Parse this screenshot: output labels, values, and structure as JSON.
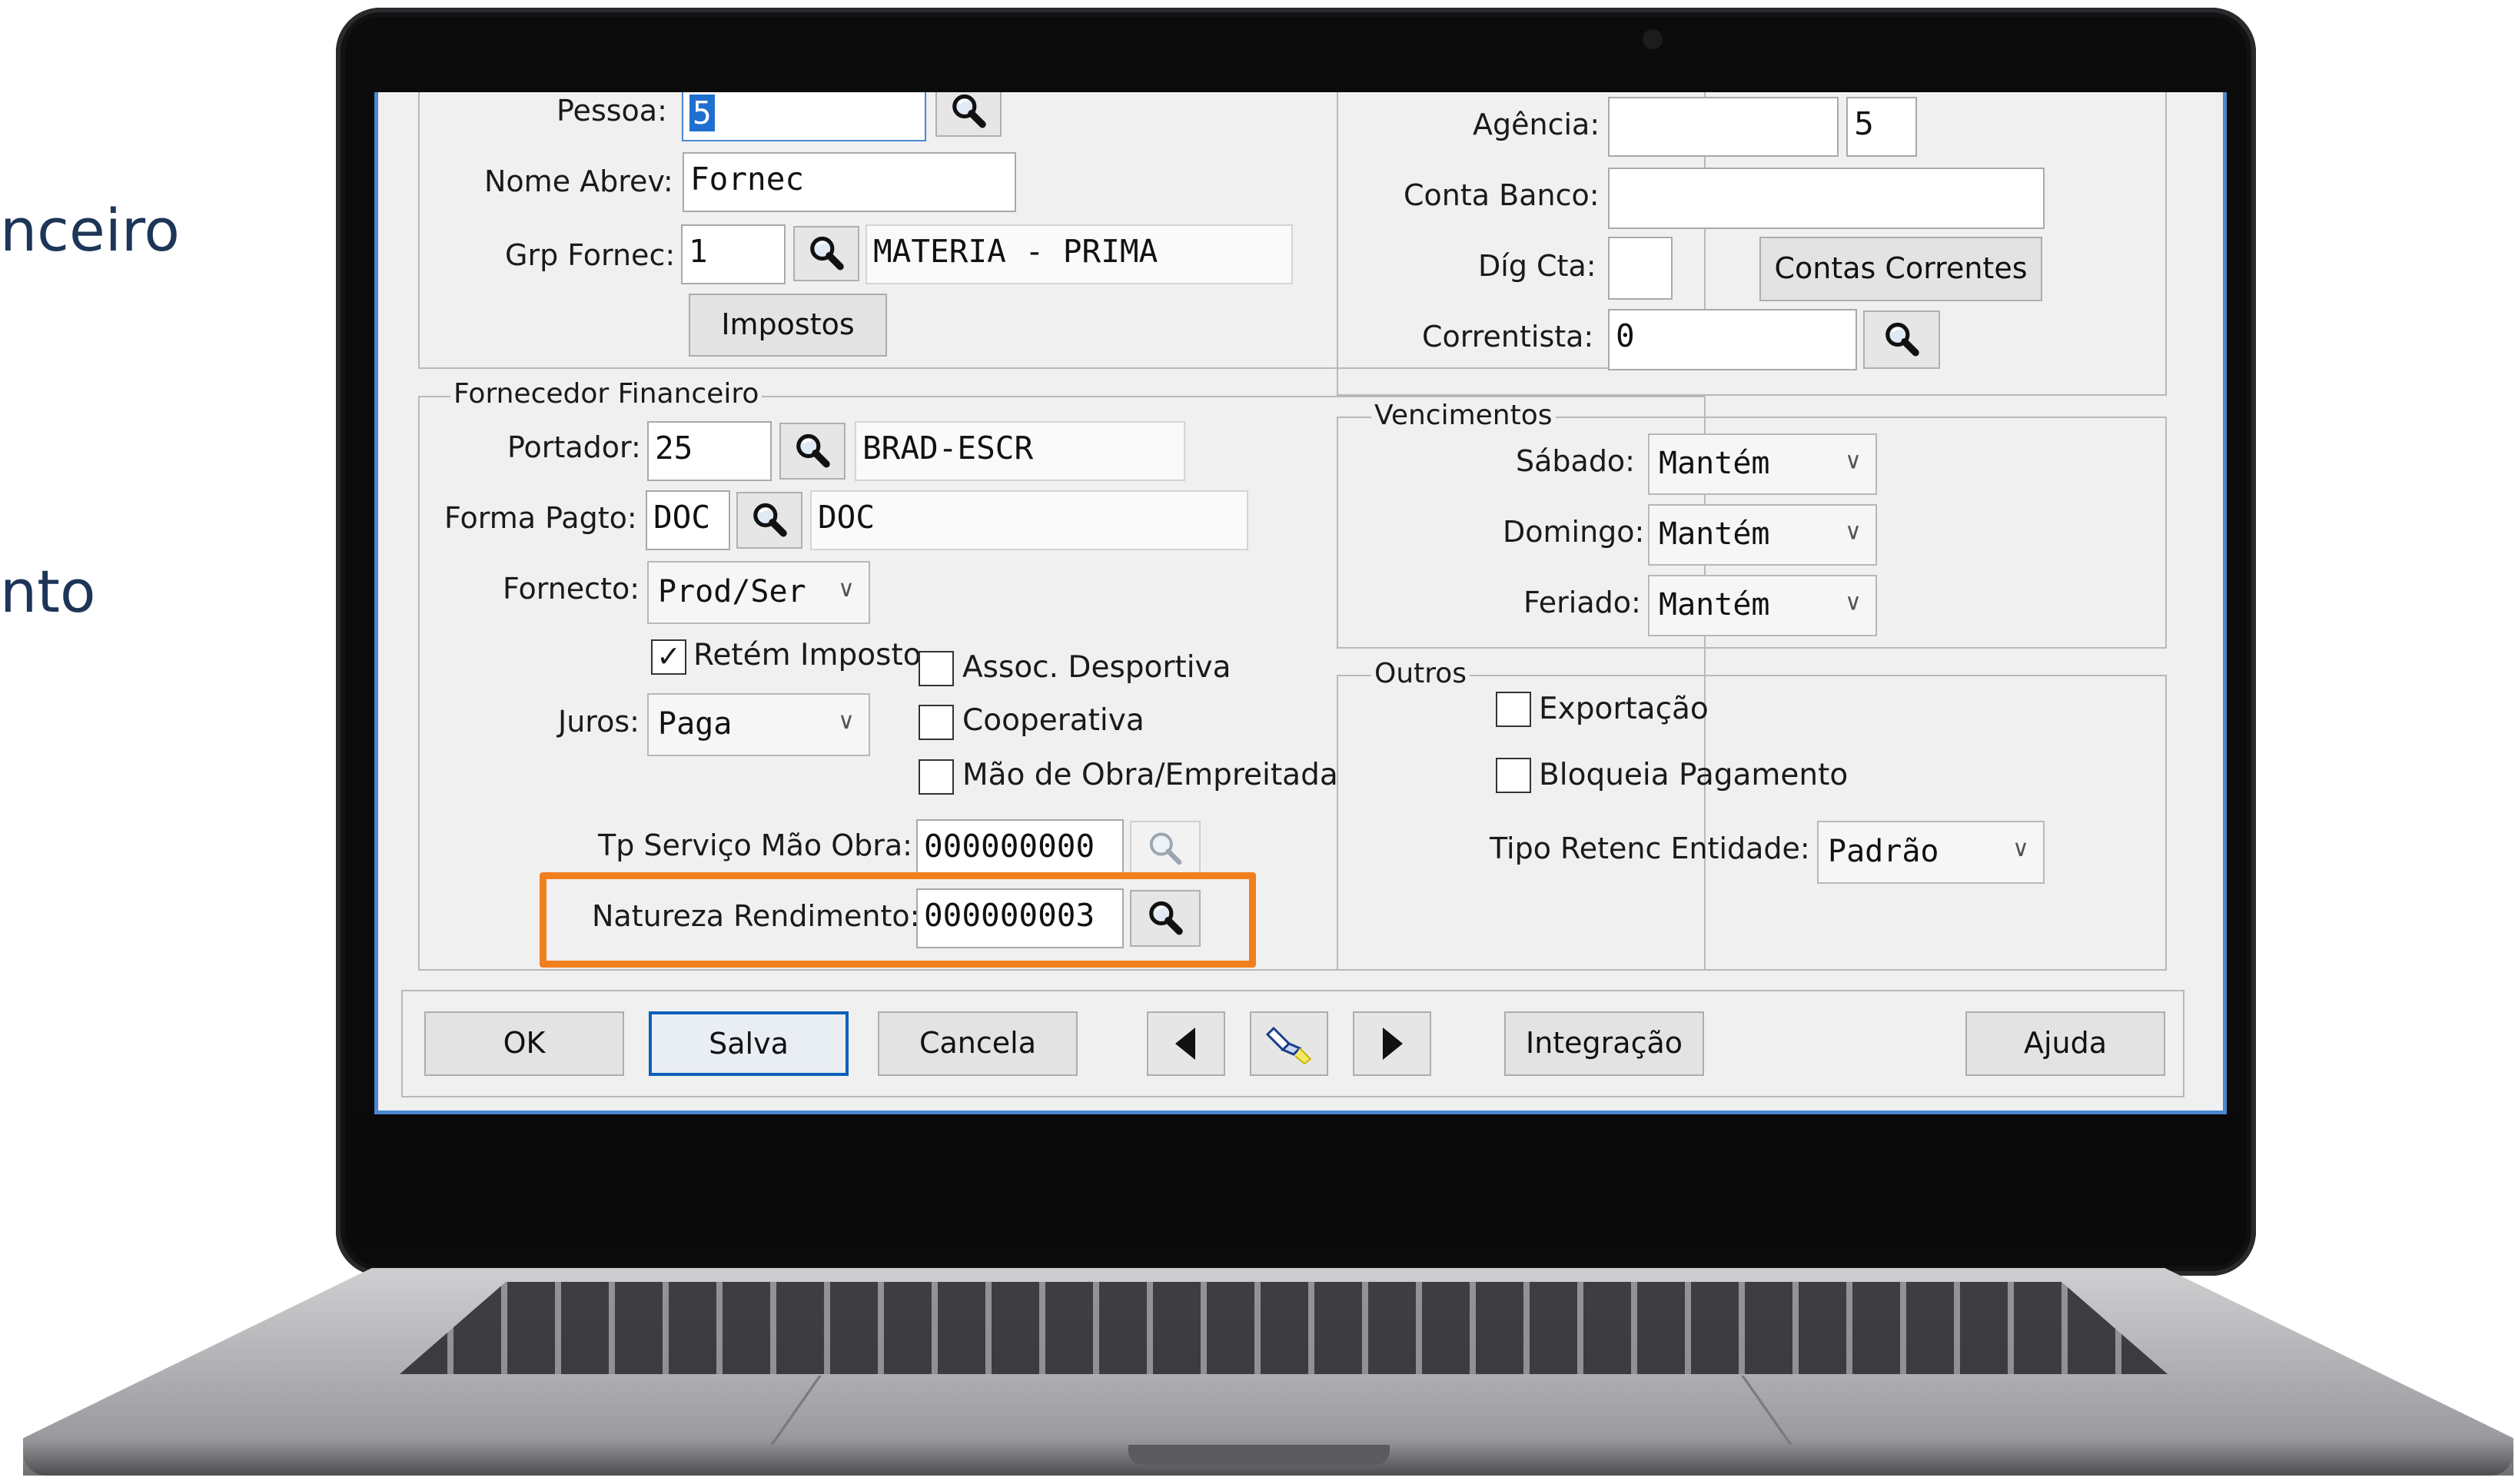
{
  "side_texts": [
    "nceiro",
    "nto"
  ],
  "form": {
    "pessoa": {
      "label": "Pessoa:",
      "value": "5"
    },
    "nome_abrev": {
      "label": "Nome Abrev:",
      "value": "Fornec"
    },
    "grp_fornec": {
      "label": "Grp Fornec:",
      "value": "1",
      "description": "MATERIA - PRIMA"
    },
    "impostos_button": "Impostos",
    "fornecedor_financeiro": {
      "legend": "Fornecedor Financeiro",
      "portador": {
        "label": "Portador:",
        "value": "25",
        "description": "BRAD-ESCR"
      },
      "forma_pagto": {
        "label": "Forma Pagto:",
        "value": "DOC",
        "description": "DOC"
      },
      "fornecto": {
        "label": "Fornecto:",
        "value": "Prod/Ser"
      },
      "retem_imposto": {
        "label": "Retém Imposto",
        "checked": true
      },
      "juros": {
        "label": "Juros:",
        "value": "Paga"
      },
      "assoc_desportiva": {
        "label": "Assoc. Desportiva",
        "checked": false
      },
      "cooperativa": {
        "label": "Cooperativa",
        "checked": false
      },
      "mao_de_obra": {
        "label": "Mão de Obra/Empreitada",
        "checked": false
      },
      "tp_servico": {
        "label": "Tp Serviço Mão Obra:",
        "value": "000000000"
      },
      "natureza_rendimento": {
        "label": "Natureza Rendimento:",
        "value": "000000003"
      }
    },
    "banco": {
      "agencia": {
        "label": "Agência:",
        "value": "",
        "digit": "5"
      },
      "conta_banco": {
        "label": "Conta Banco:",
        "value": ""
      },
      "dig_cta": {
        "label": "Díg Cta:",
        "value": ""
      },
      "contas_correntes_button": "Contas Correntes",
      "correntista": {
        "label": "Correntista:",
        "value": "0"
      }
    },
    "vencimentos": {
      "legend": "Vencimentos",
      "sabado": {
        "label": "Sábado:",
        "value": "Mantém"
      },
      "domingo": {
        "label": "Domingo:",
        "value": "Mantém"
      },
      "feriado": {
        "label": "Feriado:",
        "value": "Mantém"
      }
    },
    "outros": {
      "legend": "Outros",
      "exportacao": {
        "label": "Exportação",
        "checked": false
      },
      "bloqueia_pagamento": {
        "label": "Bloqueia Pagamento",
        "checked": false
      },
      "tipo_retenc": {
        "label": "Tipo Retenc Entidade:",
        "value": "Padrão"
      }
    }
  },
  "toolbar": {
    "ok": "OK",
    "salva": "Salva",
    "cancela": "Cancela",
    "integracao": "Integração",
    "ajuda": "Ajuda"
  },
  "icons": {
    "zoom": "magnifier-icon",
    "prev": "triangle-left-icon",
    "next": "triangle-right-icon",
    "flashlight": "flashlight-icon"
  },
  "colors": {
    "highlight": "#f07f1e",
    "window_border": "#4a88d1",
    "primary_button_border": "#0d5fb8",
    "side_text": "#1d3557"
  }
}
